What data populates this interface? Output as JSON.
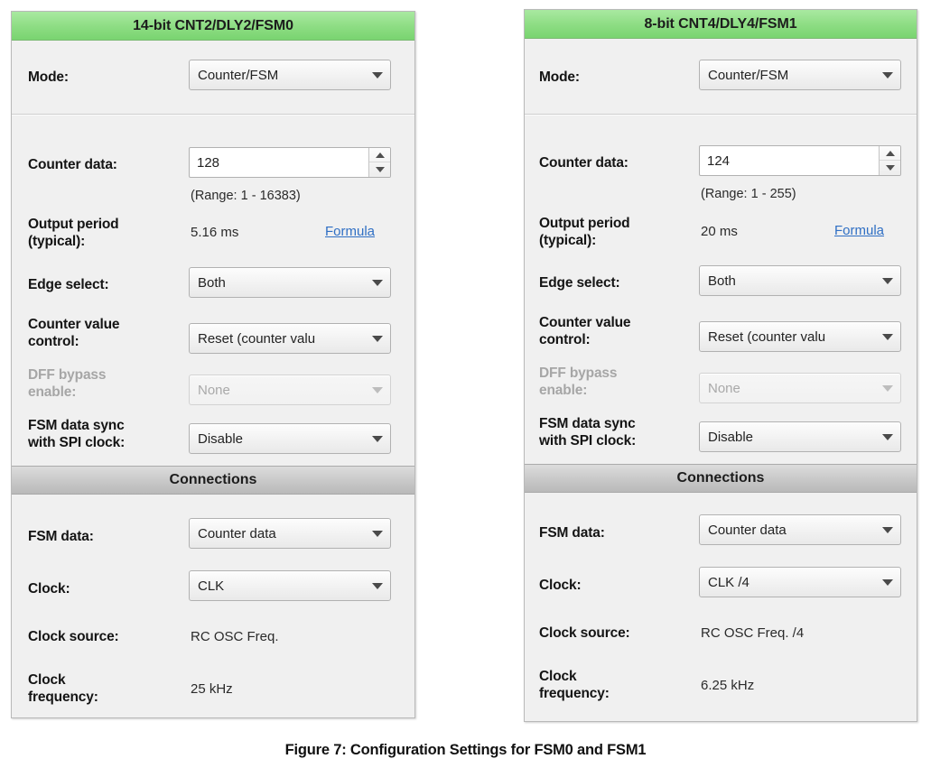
{
  "caption": "Figure 7: Configuration Settings for FSM0 and FSM1",
  "colors": {
    "header_green": "#8edd84",
    "section_gray": "#c8c8c8",
    "panel_bg": "#f0f0f0",
    "link_blue": "#2f6fc4",
    "disabled_gray": "#a9a9a9"
  },
  "icons": {
    "dropdown": "chevron-down-icon",
    "spin_up": "spinner-up-icon",
    "spin_down": "spinner-down-icon"
  },
  "panels": [
    {
      "title": "14-bit CNT2/DLY2/FSM0",
      "section_title": "Connections",
      "labels": {
        "mode": "Mode:",
        "counter_data": "Counter data:",
        "output_period": "Output period (typical):",
        "output_period_l1": "Output period",
        "output_period_l2": "(typical):",
        "edge_select": "Edge select:",
        "counter_value_control": "Counter value control:",
        "counter_value_control_l1": "Counter value",
        "counter_value_control_l2": "control:",
        "dff_bypass": "DFF bypass enable:",
        "dff_bypass_l1": "DFF bypass",
        "dff_bypass_l2": "enable:",
        "fsm_sync": "FSM data sync with SPI clock:",
        "fsm_sync_l1": "FSM data sync",
        "fsm_sync_l2": "with SPI clock:",
        "fsm_data": "FSM data:",
        "clock": "Clock:",
        "clock_source": "Clock source:",
        "clock_frequency": "Clock frequency:",
        "clock_frequency_l1": "Clock",
        "clock_frequency_l2": "frequency:"
      },
      "values": {
        "mode": "Counter/FSM",
        "counter_data": "128",
        "counter_data_range": "(Range:  1 - 16383)",
        "output_period": "5.16 ms",
        "formula_link": "Formula",
        "edge_select": "Both",
        "counter_value_control": "Reset (counter valu",
        "dff_bypass": "None",
        "fsm_sync": "Disable",
        "fsm_data": "Counter data",
        "clock": "CLK",
        "clock_source": "RC OSC Freq.",
        "clock_frequency": "25 kHz"
      }
    },
    {
      "title": "8-bit CNT4/DLY4/FSM1",
      "section_title": "Connections",
      "labels": {
        "mode": "Mode:",
        "counter_data": "Counter data:",
        "output_period": "Output period (typical):",
        "output_period_l1": "Output period",
        "output_period_l2": "(typical):",
        "edge_select": "Edge select:",
        "counter_value_control": "Counter value control:",
        "counter_value_control_l1": "Counter value",
        "counter_value_control_l2": "control:",
        "dff_bypass": "DFF bypass enable:",
        "dff_bypass_l1": "DFF bypass",
        "dff_bypass_l2": "enable:",
        "fsm_sync": "FSM data sync with SPI clock:",
        "fsm_sync_l1": "FSM data sync",
        "fsm_sync_l2": "with SPI clock:",
        "fsm_data": "FSM data:",
        "clock": "Clock:",
        "clock_source": "Clock source:",
        "clock_frequency": "Clock frequency:",
        "clock_frequency_l1": "Clock",
        "clock_frequency_l2": "frequency:"
      },
      "values": {
        "mode": "Counter/FSM",
        "counter_data": "124",
        "counter_data_range": "(Range:  1 - 255)",
        "output_period": "20 ms",
        "formula_link": "Formula",
        "edge_select": "Both",
        "counter_value_control": "Reset (counter valu",
        "dff_bypass": "None",
        "fsm_sync": "Disable",
        "fsm_data": "Counter data",
        "clock": "CLK /4",
        "clock_source": "RC OSC Freq. /4",
        "clock_frequency": "6.25 kHz"
      }
    }
  ]
}
